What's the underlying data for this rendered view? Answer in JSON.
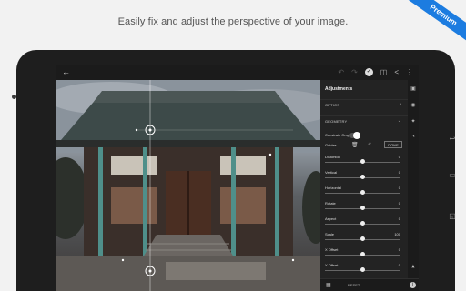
{
  "headline": "Easily fix and adjust the perspective of your image.",
  "ribbon": "Premium",
  "topbar": {
    "back_icon": "arrow-left-icon",
    "icons": [
      "undo-icon",
      "redo-icon",
      "check-icon",
      "compare-icon",
      "share-icon",
      "more-icon"
    ]
  },
  "panel": {
    "title": "Adjustments",
    "sections": [
      {
        "label": "OPTICS",
        "state": "collapsed"
      },
      {
        "label": "GEOMETRY",
        "state": "expanded"
      }
    ],
    "constrain_crop_label": "Constrain Crop",
    "guides_label": "Guides",
    "done_label": "DONE",
    "sliders": [
      {
        "name": "Distortion",
        "value": "0",
        "position": 0.5
      },
      {
        "name": "Vertical",
        "value": "0",
        "position": 0.5
      },
      {
        "name": "Horizontal",
        "value": "0",
        "position": 0.5
      },
      {
        "name": "Rotate",
        "value": "0",
        "position": 0.5
      },
      {
        "name": "Aspect",
        "value": "0",
        "position": 0.5
      },
      {
        "name": "Scale",
        "value": "100",
        "position": 0.5
      },
      {
        "name": "X Offset",
        "value": "0",
        "position": 0.5
      },
      {
        "name": "Y Offset",
        "value": "0",
        "position": 0.5
      }
    ]
  },
  "bottombar": {
    "reset_label": "RESET"
  },
  "colors": {
    "ribbon": "#1c7ce0",
    "panel_bg": "#232323",
    "teal_pillars": "#4f8f8a"
  }
}
